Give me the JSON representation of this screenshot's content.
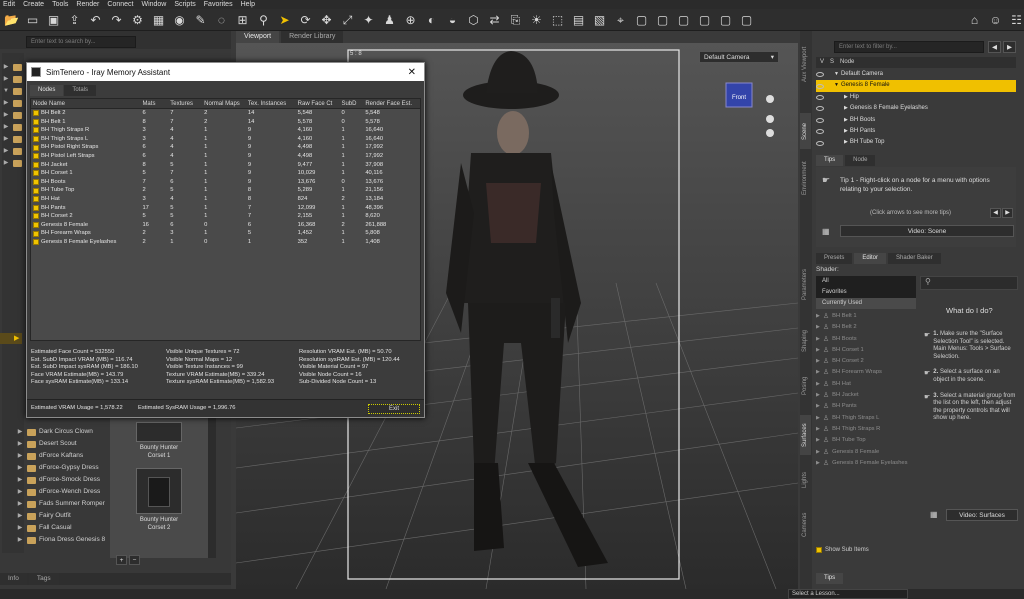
{
  "menu": [
    "Edit",
    "Create",
    "Tools",
    "Render",
    "Connect",
    "Window",
    "Scripts",
    "Favorites",
    "Help"
  ],
  "left": {
    "search_placeholder": "Enter text to search by...",
    "items": [
      "Dark Circus Clown",
      "Desert Scout",
      "dForce Kaftans",
      "dForce-Gypsy Dress",
      "dForce-Smock Dress",
      "dForce-Wench Dress",
      "Fads Summer Romper",
      "Fairy Outfit",
      "Fall Casual",
      "Fiona Dress Genesis 8"
    ],
    "thumbs": [
      "Bounty Hunter\nCorset 1",
      "Bounty Hunter\nCorset 2"
    ],
    "bottom_tabs": [
      "Info",
      "Tags"
    ]
  },
  "viewport": {
    "tabs": [
      "Viewport",
      "Render Library"
    ],
    "camera": "Default Camera",
    "corner_label": "5 : 8",
    "cube_label": "Front"
  },
  "dialog": {
    "title": "SimTenero - Iray Memory Assistant",
    "tabs": [
      "Nodes",
      "Totals"
    ],
    "columns": [
      "Node Name",
      "Mats",
      "Textures",
      "Normal Maps",
      "Tex. Instances",
      "Raw Face Ct",
      "SubD",
      "Render Face Est."
    ],
    "rows": [
      [
        "BH Belt 2",
        "6",
        "7",
        "2",
        "14",
        "5,548",
        "0",
        "5,548"
      ],
      [
        "BH Belt 1",
        "8",
        "7",
        "2",
        "14",
        "5,578",
        "0",
        "5,578"
      ],
      [
        "BH Thigh Straps R",
        "3",
        "4",
        "1",
        "9",
        "4,160",
        "1",
        "16,640"
      ],
      [
        "BH Thigh Straps L",
        "3",
        "4",
        "1",
        "9",
        "4,160",
        "1",
        "16,640"
      ],
      [
        "BH Pistol Right Straps",
        "6",
        "4",
        "1",
        "9",
        "4,498",
        "1",
        "17,992"
      ],
      [
        "BH Pistol Left Straps",
        "6",
        "4",
        "1",
        "9",
        "4,498",
        "1",
        "17,992"
      ],
      [
        "BH Jacket",
        "8",
        "5",
        "1",
        "9",
        "9,477",
        "1",
        "37,908"
      ],
      [
        "BH Corset 1",
        "5",
        "7",
        "1",
        "9",
        "10,029",
        "1",
        "40,116"
      ],
      [
        "BH Boots",
        "7",
        "6",
        "1",
        "9",
        "13,676",
        "0",
        "13,676"
      ],
      [
        "BH Tube Top",
        "2",
        "5",
        "1",
        "8",
        "5,289",
        "1",
        "21,156"
      ],
      [
        "BH Hat",
        "3",
        "4",
        "1",
        "8",
        "824",
        "2",
        "13,184"
      ],
      [
        "BH Pants",
        "17",
        "5",
        "1",
        "7",
        "12,099",
        "1",
        "48,396"
      ],
      [
        "BH Corset 2",
        "5",
        "5",
        "1",
        "7",
        "2,155",
        "1",
        "8,620"
      ],
      [
        "Genesis 8 Female",
        "16",
        "6",
        "0",
        "6",
        "16,368",
        "2",
        "261,888"
      ],
      [
        "BH Forearm Wraps",
        "2",
        "3",
        "1",
        "5",
        "1,452",
        "1",
        "5,808"
      ],
      [
        "Genesis 8 Female Eyelashes",
        "2",
        "1",
        "0",
        "1",
        "352",
        "1",
        "1,408"
      ]
    ],
    "stats_col1": [
      "Estimated Face Count = 532550",
      "Est. SubD Impact VRAM (MB) = 116.74",
      "Est. SubD Impact sysRAM (MB) = 186.10",
      "Face VRAM Estimate(MB) = 143.79",
      "Face sysRAM Estimate(MB) = 133.14"
    ],
    "stats_col2": [
      "Visible Unique Textures = 72",
      "Visible Normal Maps = 12",
      "Visible Texture Instances = 99",
      "Texture VRAM Estimate(MB) = 339.24",
      "Texture sysRAM Estimate(MB) = 1,582.93"
    ],
    "stats_col3": [
      "Resolution VRAM Est. (MB) = 50.70",
      "Resolution sysRAM Est. (MB) = 120.44",
      "Visible Material Count = 97",
      "Visible Node Count = 16",
      "Sub-Divided Node Count = 13"
    ],
    "vram_usage": "Estimated VRAM Usage = 1,578.22",
    "sysram_usage": "Estimated SysRAM Usage = 1,996.76",
    "exit": "Exit"
  },
  "right": {
    "filter_placeholder": "Enter text to filter by...",
    "scene_header": [
      "V",
      "S",
      "Node"
    ],
    "scene_nodes": [
      {
        "label": "Default Camera",
        "indent": 0,
        "sel": false
      },
      {
        "label": "Genesis 8 Female",
        "indent": 0,
        "sel": true
      },
      {
        "label": "Hip",
        "indent": 1,
        "sel": false
      },
      {
        "label": "Genesis 8 Female Eyelashes",
        "indent": 1,
        "sel": false
      },
      {
        "label": "BH Boots",
        "indent": 1,
        "sel": false
      },
      {
        "label": "BH Pants",
        "indent": 1,
        "sel": false
      },
      {
        "label": "BH Tube Top",
        "indent": 1,
        "sel": false
      }
    ],
    "tips_tabs": [
      "Tips",
      "Node"
    ],
    "tip_text": "Tip 1 - Right-click on a node for a menu with options relating to your selection.",
    "tip_nav": "(Click arrows to see more tips)",
    "video_scene": "Video: Scene",
    "surface_tabs": [
      "Presets",
      "Editor",
      "Shader Baker"
    ],
    "shader_label": "Shader:",
    "shader_options": [
      "All",
      "Favorites",
      "Currently Used"
    ],
    "surface_items": [
      "BH Belt 1",
      "BH Belt 2",
      "BH Boots",
      "BH Corset 1",
      "BH Corset 2",
      "BH Forearm Wraps",
      "BH Hat",
      "BH Jacket",
      "BH Pants",
      "BH Thigh Straps L",
      "BH Thigh Straps R",
      "BH Tube Top",
      "Genesis 8 Female",
      "Genesis 8 Female Eyelashes"
    ],
    "what_do_title": "What do I do?",
    "steps": [
      "Make sure the \"Surface Selection Tool\" is selected. Main Menus: Tools > Surface Selection.",
      "Select a surface on an object in the scene.",
      "Select a material group from the list on the left, then adjust the property controls that will show up here."
    ],
    "video_surfaces": "Video: Surfaces",
    "show_sub_items": "Show Sub Items",
    "bottom_tab": "Tips",
    "side_tabs_top": [
      "Aux Viewport",
      "Scene",
      "Environment"
    ],
    "side_tabs_bottom": [
      "Parameters",
      "Shaping",
      "Posing",
      "Surfaces",
      "Lights",
      "Cameras"
    ]
  },
  "status": {
    "lesson": "Select a Lesson..."
  }
}
